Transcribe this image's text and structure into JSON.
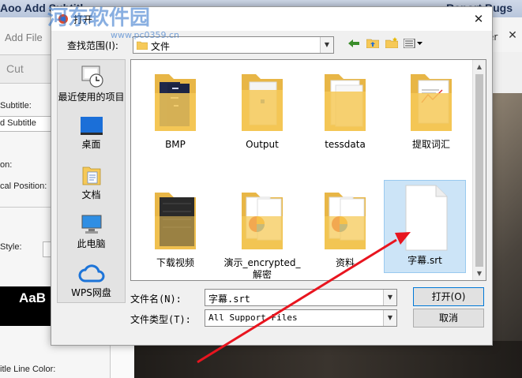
{
  "background_app": {
    "title": "Aoo Add Subtitl",
    "report": "Report Bugs",
    "toolbar_add_file": "Add File",
    "toolbar_er": "er",
    "cut_label": "Cut",
    "labels": {
      "subtitle": "Subtitle:",
      "add_subtitle": "d Subtitle",
      "position": "on:",
      "vertical_position": "cal Position:",
      "style": "Style:",
      "subtitle_line_color": "itle Line Color:"
    },
    "preview_text": "AaB"
  },
  "watermark": {
    "text": "河东软件园",
    "url": "www.pc0359.cn"
  },
  "dialog": {
    "title": "打开",
    "look_in_label": "查找范围(I):",
    "look_in_value": "文件",
    "places": [
      {
        "label": "最近使用的项目",
        "icon": "recent-places-icon"
      },
      {
        "label": "桌面",
        "icon": "desktop-icon"
      },
      {
        "label": "文档",
        "icon": "documents-icon"
      },
      {
        "label": "此电脑",
        "icon": "this-pc-icon"
      },
      {
        "label": "WPS网盘",
        "icon": "wps-cloud-icon"
      }
    ],
    "files": [
      {
        "name": "BMP",
        "type": "folder"
      },
      {
        "name": "Output",
        "type": "folder"
      },
      {
        "name": "tessdata",
        "type": "folder"
      },
      {
        "name": "提取词汇",
        "type": "folder"
      },
      {
        "name": "下载视频",
        "type": "folder"
      },
      {
        "name": "演示_encrypted_",
        "name2": "解密",
        "type": "folder"
      },
      {
        "name": "资料",
        "type": "folder"
      },
      {
        "name": "字幕.srt",
        "type": "file",
        "selected": true
      }
    ],
    "filename_label": "文件名(N):",
    "filename_value": "字幕.srt",
    "filetype_label": "文件类型(T):",
    "filetype_value": "All Support Files",
    "open_button": "打开(O)",
    "cancel_button": "取消"
  },
  "colors": {
    "selection": "#cce4f7",
    "folder": "#f6c958",
    "annotation_arrow": "#e8151f"
  }
}
